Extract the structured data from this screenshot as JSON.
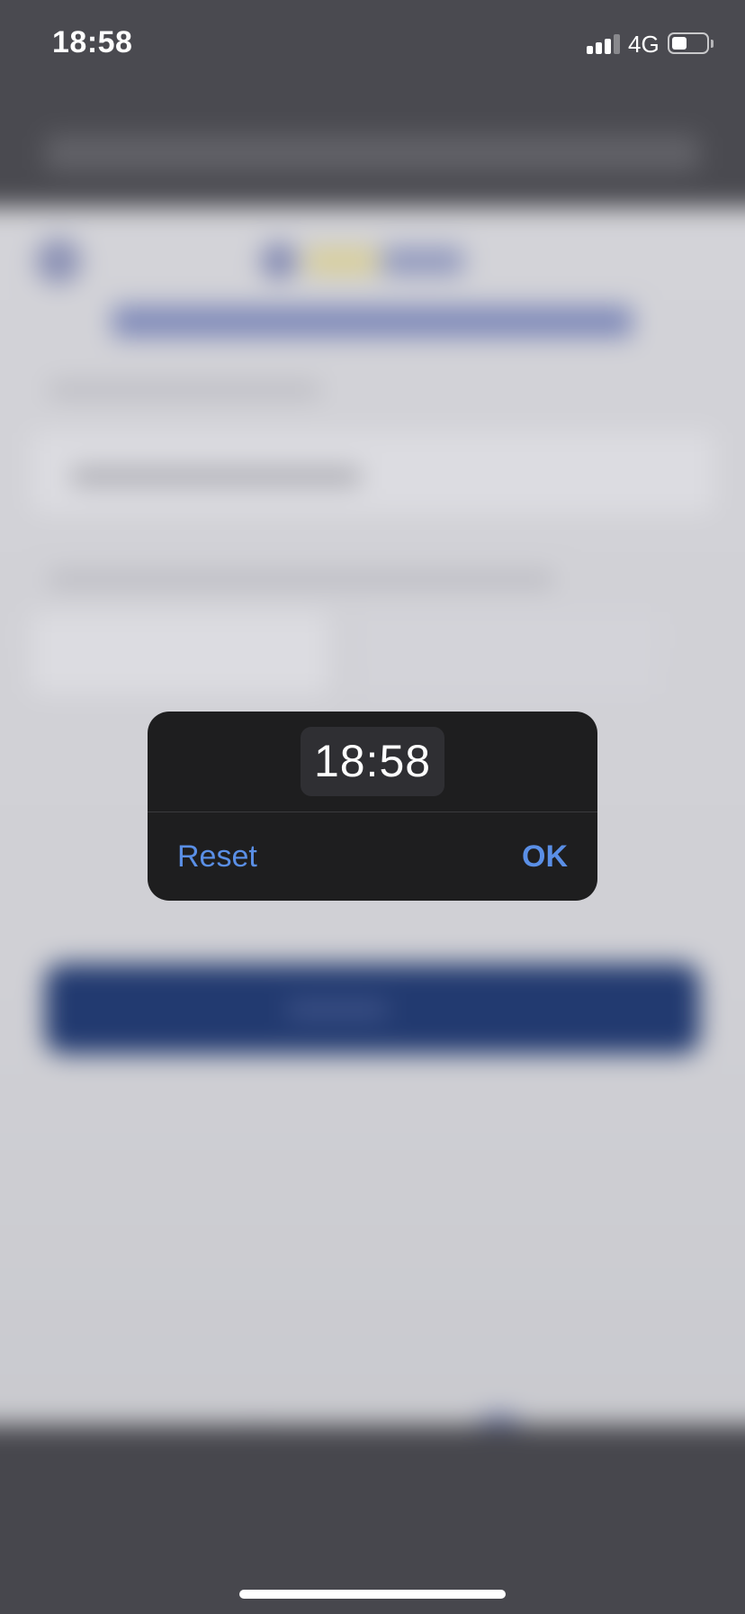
{
  "status_bar": {
    "time": "18:58",
    "network": "4G",
    "signal_bars": 3,
    "battery_level": 0.45
  },
  "time_picker": {
    "value": "18:58",
    "reset_label": "Reset",
    "ok_label": "OK",
    "accent_color": "#5a8fe6"
  }
}
